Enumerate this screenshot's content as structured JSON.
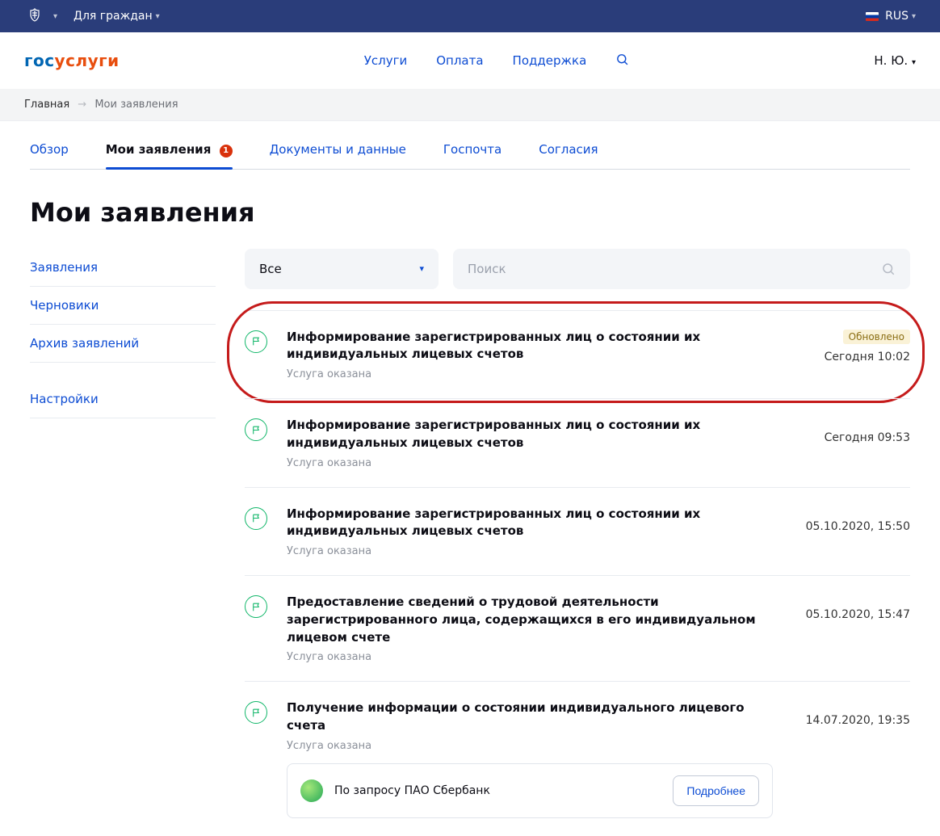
{
  "govbar": {
    "audience": "Для граждан",
    "lang": "RUS"
  },
  "nav": {
    "logo_l": "гос",
    "logo_r": "услуги",
    "link_services": "Услуги",
    "link_pay": "Оплата",
    "link_support": "Поддержка",
    "user": "Н. Ю."
  },
  "crumbs": {
    "root": "Главная",
    "current": "Мои заявления"
  },
  "tabs": {
    "t0": "Обзор",
    "t1": "Мои заявления",
    "badge": "1",
    "t2": "Документы и данные",
    "t3": "Госпочта",
    "t4": "Согласия"
  },
  "h1": "Мои заявления",
  "side": {
    "s0": "Заявления",
    "s1": "Черновики",
    "s2": "Архив заявлений",
    "s3": "Настройки"
  },
  "filters": {
    "select": "Все",
    "search_ph": "Поиск"
  },
  "badges": {
    "updated": "Обновлено"
  },
  "apps": {
    "0": {
      "title": "Информирование зарегистрированных лиц о состоянии их индивидуальных лицевых счетов",
      "status": "Услуга оказана",
      "time": "Сегодня 10:02"
    },
    "1": {
      "title": "Информирование зарегистрированных лиц о состоянии их индивидуальных лицевых счетов",
      "status": "Услуга оказана",
      "time": "Сегодня 09:53"
    },
    "2": {
      "title": "Информирование зарегистрированных лиц о состоянии их индивидуальных лицевых счетов",
      "status": "Услуга оказана",
      "time": "05.10.2020, 15:50"
    },
    "3": {
      "title": "Предоставление сведений о трудовой деятельности зарегистрированного лица, содержащихся в его индивидуальном лицевом счете",
      "status": "Услуга оказана",
      "time": "05.10.2020, 15:47"
    },
    "4": {
      "title": "Получение информации о состоянии индивидуального лицевого счета",
      "status": "Услуга оказана",
      "time": "14.07.2020, 19:35"
    }
  },
  "note": {
    "text": "По запросу ПАО Сбербанк",
    "btn": "Подробнее"
  }
}
